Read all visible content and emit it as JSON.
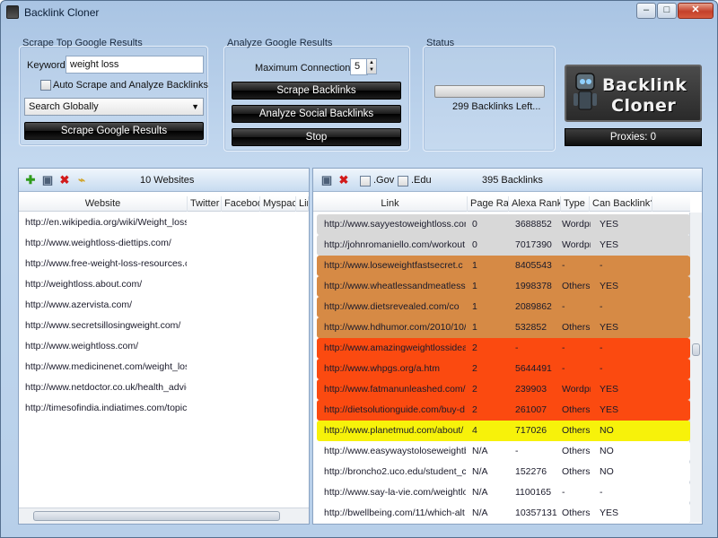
{
  "window": {
    "title": "Backlink Cloner"
  },
  "scrape": {
    "group_title": "Scrape Top Google Results",
    "keyword_label": "Keyword:",
    "keyword_value": "weight loss",
    "auto_label": "Auto Scrape and Analyze Backlinks",
    "scope_value": "Search Globally",
    "button": "Scrape Google Results"
  },
  "analyze": {
    "group_title": "Analyze Google Results",
    "max_conn_label": "Maximum Connections:",
    "max_conn_value": "5",
    "scrape_backlinks": "Scrape Backlinks",
    "analyze_social": "Analyze Social Backlinks",
    "stop": "Stop"
  },
  "status": {
    "group_title": "Status",
    "progress_fraction": 0.0,
    "text": "299 Backlinks Left..."
  },
  "logo": {
    "line1": "Backlink",
    "line2": "Cloner"
  },
  "proxies": "Proxies: 0",
  "websites": {
    "count": "10 Websites",
    "headers": [
      "Website",
      "Twitter",
      "Facebook",
      "Myspace",
      "Lin"
    ],
    "rows": [
      "http://en.wikipedia.org/wiki/Weight_loss",
      "http://www.weightloss-diettips.com/",
      "http://www.free-weight-loss-resources.co",
      "http://weightloss.about.com/",
      "http://www.azervista.com/",
      "http://www.secretsillosingweight.com/",
      "http://www.weightloss.com/",
      "http://www.medicinenet.com/weight_loss",
      "http://www.netdoctor.co.uk/health_advic",
      "http://timesofindia.indiatimes.com/topic"
    ]
  },
  "backlinks": {
    "gov_label": ".Gov",
    "edu_label": ".Edu",
    "count": "395 Backlinks",
    "headers": [
      "Link",
      "Page Rank",
      "Alexa Rank",
      "Type",
      "Can Backlink?"
    ],
    "rows": [
      {
        "link": "http://www.sayyestoweightloss.com",
        "pr": "0",
        "alexa": "3688852",
        "type": "Wordpr",
        "can": "YES",
        "color": "#d8d8d8"
      },
      {
        "link": "http://johnromaniello.com/workout",
        "pr": "0",
        "alexa": "7017390",
        "type": "Wordpr",
        "can": "YES",
        "color": "#d8d8d8"
      },
      {
        "link": "http://www.loseweightfastsecret.c",
        "pr": "1",
        "alexa": "8405543",
        "type": "-",
        "can": "-",
        "color": "#d68a45"
      },
      {
        "link": "http://www.wheatlessandmeatless.c",
        "pr": "1",
        "alexa": "1998378",
        "type": "Others",
        "can": "YES",
        "color": "#d68a45"
      },
      {
        "link": "http://www.dietsrevealed.com/co",
        "pr": "1",
        "alexa": "2089862",
        "type": "-",
        "can": "-",
        "color": "#d68a45"
      },
      {
        "link": "http://www.hdhumor.com/2010/10/",
        "pr": "1",
        "alexa": "532852",
        "type": "Others",
        "can": "YES",
        "color": "#d68a45"
      },
      {
        "link": "http://www.amazingweightlossidea",
        "pr": "2",
        "alexa": "-",
        "type": "-",
        "can": "-",
        "color": "#fb4a10"
      },
      {
        "link": "http://www.whpgs.org/a.htm",
        "pr": "2",
        "alexa": "5644491",
        "type": "-",
        "can": "-",
        "color": "#fb4a10"
      },
      {
        "link": "http://www.fatmanunleashed.com/c",
        "pr": "2",
        "alexa": "239903",
        "type": "Wordpr",
        "can": "YES",
        "color": "#fb4a10"
      },
      {
        "link": "http://dietsolutionguide.com/buy-d",
        "pr": "2",
        "alexa": "261007",
        "type": "Others",
        "can": "YES",
        "color": "#fb4a10"
      },
      {
        "link": "http://www.planetmud.com/about/",
        "pr": "4",
        "alexa": "717026",
        "type": "Others",
        "can": "NO",
        "color": "#f7f20a"
      },
      {
        "link": "http://www.easywaystoloseweightb",
        "pr": "N/A",
        "alexa": "-",
        "type": "Others",
        "can": "NO",
        "color": "#ffffff"
      },
      {
        "link": "http://broncho2.uco.edu/student_cc",
        "pr": "N/A",
        "alexa": "152276",
        "type": "Others",
        "can": "NO",
        "color": "#ffffff"
      },
      {
        "link": "http://www.say-la-vie.com/weightlo",
        "pr": "N/A",
        "alexa": "1100165",
        "type": "-",
        "can": "-",
        "color": "#ffffff"
      },
      {
        "link": "http://bwellbeing.com/11/which-alt",
        "pr": "N/A",
        "alexa": "10357131",
        "type": "Others",
        "can": "YES",
        "color": "#ffffff"
      }
    ]
  },
  "icons": {
    "add": "plus-icon",
    "save": "save-icon",
    "delete": "delete-icon",
    "clear": "broom-icon"
  }
}
